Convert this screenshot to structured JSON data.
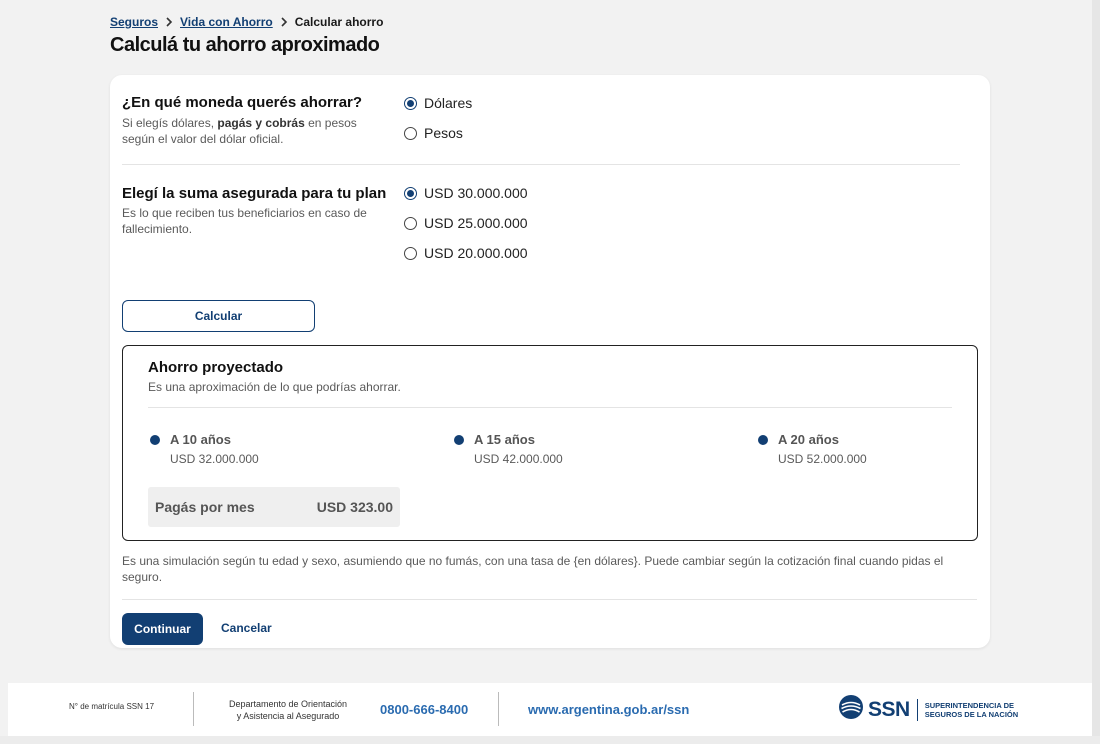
{
  "breadcrumb": {
    "items": [
      "Seguros",
      "Vida con Ahorro"
    ],
    "current": "Calcular ahorro"
  },
  "page_title": "Calculá tu ahorro aproximado",
  "currency_question": {
    "title": "¿En qué moneda querés ahorrar?",
    "desc_pre": "Si elegís dólares, ",
    "desc_bold": "pagás y cobrás",
    "desc_post": " en pesos según el valor del dólar oficial.",
    "options": [
      {
        "label": "Dólares",
        "selected": true
      },
      {
        "label": "Pesos",
        "selected": false
      }
    ]
  },
  "sum_question": {
    "title": "Elegí la suma asegurada para tu plan",
    "desc": "Es lo que reciben tus beneficiarios en caso de fallecimiento.",
    "options": [
      {
        "label": "USD 30.000.000",
        "selected": true
      },
      {
        "label": "USD 25.000.000",
        "selected": false
      },
      {
        "label": "USD 20.000.000",
        "selected": false
      }
    ]
  },
  "calculate_label": "Calcular",
  "result": {
    "title": "Ahorro proyectado",
    "desc": "Es una aproximación de lo que podrías ahorrar.",
    "projections": [
      {
        "label": "A 10 años",
        "value": "USD 32.000.000"
      },
      {
        "label": "A 15 años",
        "value": "USD 42.000.000"
      },
      {
        "label": "A 20 años",
        "value": "USD 52.000.000"
      }
    ],
    "monthly_label": "Pagás por mes",
    "monthly_value": "USD 323.00"
  },
  "disclaimer": "Es una simulación según tu edad y sexo, asumiendo que no fumás, con una tasa de {en dólares}. Puede cambiar según la cotización final cuando pidas el seguro.",
  "continue_label": "Continuar",
  "cancel_label": "Cancelar",
  "footer": {
    "matricula": "N° de matrícula SSN 17",
    "dept_line1": "Departamento de Orientación",
    "dept_line2": "y Asistencia al Asegurado",
    "phone": "0800-666-8400",
    "website": "www.argentina.gob.ar/ssn",
    "logo_text": "SSN",
    "org_line1": "SUPERINTENDENCIA DE",
    "org_line2": "SEGUROS DE LA NACIÓN"
  },
  "colors": {
    "primary": "#123f73",
    "link_blue": "#2a6bb0"
  },
  "icons": [
    "chevron-right-icon",
    "radio-icon",
    "ssn-logo-icon"
  ]
}
